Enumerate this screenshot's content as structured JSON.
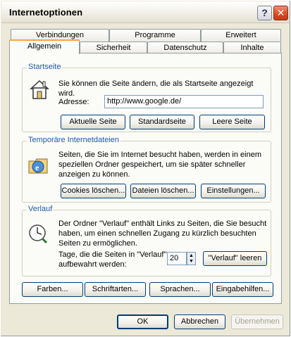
{
  "window": {
    "title": "Internetoptionen"
  },
  "tabs_back": [
    "Verbindungen",
    "Programme",
    "Erweitert"
  ],
  "tabs_front": [
    "Allgemein",
    "Sicherheit",
    "Datenschutz",
    "Inhalte"
  ],
  "startseite": {
    "legend": "Startseite",
    "text": "Sie können die Seite ändern, die als Startseite angezeigt wird.",
    "address_label": "Adresse:",
    "address_value": "http://www.google.de/",
    "buttons": [
      "Aktuelle Seite",
      "Standardseite",
      "Leere Seite"
    ]
  },
  "temp": {
    "legend": "Temporäre Internetdateien",
    "text": "Seiten, die Sie im Internet besucht haben, werden in einem speziellen Ordner gespeichert, um sie später schneller anzeigen zu können.",
    "buttons": [
      "Cookies löschen...",
      "Dateien löschen...",
      "Einstellungen..."
    ]
  },
  "verlauf": {
    "legend": "Verlauf",
    "text": "Der Ordner \"Verlauf\" enthält Links zu Seiten, die Sie besucht haben, um einen schnellen Zugang zu kürzlich besuchten Seiten zu ermöglichen.",
    "days_label": "Tage, die die Seiten in \"Verlauf\" aufbewahrt werden:",
    "days_value": "20",
    "clear_button": "\"Verlauf\" leeren"
  },
  "bottom_buttons": [
    "Farben...",
    "Schriftarten...",
    "Sprachen...",
    "Eingabehilfen..."
  ],
  "dialog_buttons": {
    "ok": "OK",
    "cancel": "Abbrechen",
    "apply": "Übernehmen"
  }
}
